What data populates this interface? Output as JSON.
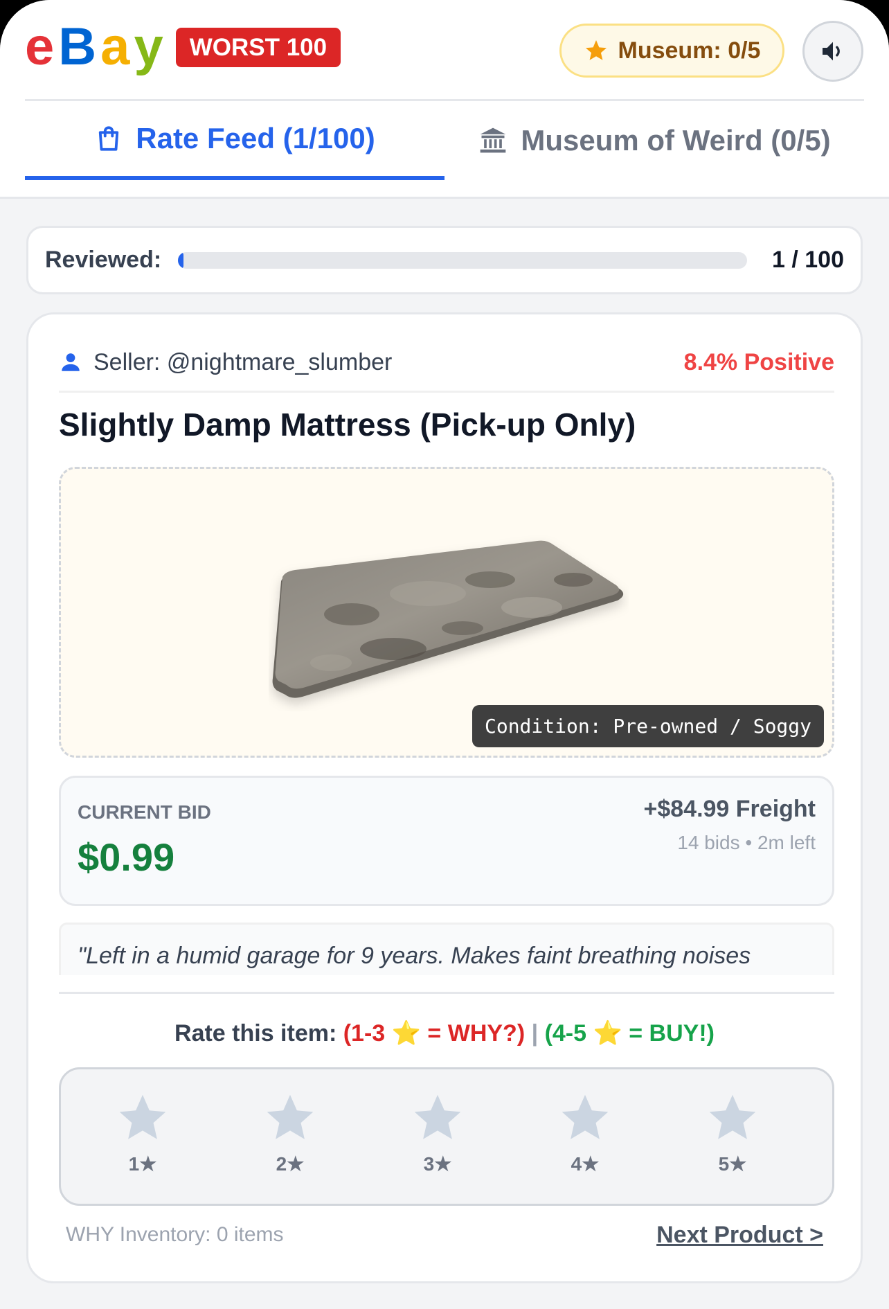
{
  "header": {
    "logo_letters": [
      {
        "char": "e",
        "color": "#e53238"
      },
      {
        "char": "B",
        "color": "#0064d2"
      },
      {
        "char": "a",
        "color": "#f5af02"
      },
      {
        "char": "y",
        "color": "#86b817"
      }
    ],
    "badge": "WORST 100",
    "museum_counter": "Museum: 0/5",
    "sound_icon": "speaker-icon"
  },
  "tabs": [
    {
      "label": "Rate Feed (1/100)",
      "icon": "shopping-bag-icon",
      "active": true
    },
    {
      "label": "Museum of Weird (0/5)",
      "icon": "museum-icon",
      "active": false
    }
  ],
  "progress": {
    "label": "Reviewed:",
    "count": "1 / 100",
    "fraction": 0.01
  },
  "listing": {
    "seller": "Seller: @nightmare_slumber",
    "rating": "8.4% Positive",
    "title": "Slightly Damp Mattress (Pick-up Only)",
    "condition": "Condition: Pre-owned / Soggy",
    "bid_label": "CURRENT BID",
    "bid_amount": "$0.99",
    "freight": "+$84.99 Freight",
    "bid_meta": "14 bids • 2m left",
    "description": "\"Left in a humid garage for 9 years. Makes faint breathing noises"
  },
  "rating": {
    "prompt_label": "Rate this item:",
    "why_hint": "(1-3 ⭐ = WHY?)",
    "separator": "|",
    "buy_hint": "(4-5 ⭐ = BUY!)",
    "stars": [
      "1★",
      "2★",
      "3★",
      "4★",
      "5★"
    ]
  },
  "footer": {
    "inventory": "WHY Inventory: 0 items",
    "next": "Next Product >"
  },
  "colors": {
    "accent": "#2563eb",
    "badge_red": "#dc2626",
    "price_green": "#15803d",
    "star_gray": "#cbd5e1"
  }
}
